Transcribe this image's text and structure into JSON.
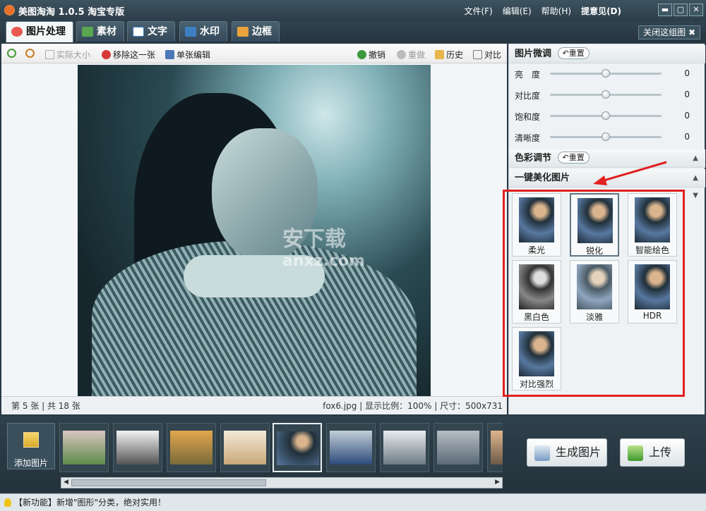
{
  "titlebar": {
    "title": "美图淘淘 1.0.5 淘宝专版"
  },
  "menu": [
    {
      "label": "文件(F)"
    },
    {
      "label": "编辑(E)"
    },
    {
      "label": "帮助(H)"
    },
    {
      "label": "提意见(D)"
    }
  ],
  "window_buttons": {
    "minimize": "▬",
    "maximize": "▢",
    "close": "✕"
  },
  "tabs": [
    {
      "label": "图片处理",
      "icon": "palette-icon",
      "color": "#e85a4f"
    },
    {
      "label": "素材",
      "icon": "material-icon",
      "color": "#5aa64f"
    },
    {
      "label": "文字",
      "icon": "text-icon",
      "color": "#3d7fc2"
    },
    {
      "label": "水印",
      "icon": "watermark-icon",
      "color": "#3d7fc2"
    },
    {
      "label": "边框",
      "icon": "frame-icon",
      "color": "#e8a33d"
    }
  ],
  "close_group": "关闭这组图 ✖",
  "toolbar": {
    "actual_size": "实际大小",
    "remove": "移除这一张",
    "single_edit": "单张编辑",
    "undo": "撤销",
    "redo": "重做",
    "history": "历史",
    "compare": "对比"
  },
  "watermark": {
    "main": "安下载",
    "sub": "anxz.com"
  },
  "status": {
    "index": "第 5 张",
    "total": "共 18 张",
    "file": "fox6.jpg",
    "zoom": "显示比例：100%",
    "size": "尺寸：500x731"
  },
  "panel": {
    "fine_tune": "图片微调",
    "reset": "重置",
    "sliders": [
      {
        "label": "亮　度",
        "value": 0,
        "fraction": 0.5
      },
      {
        "label": "对比度",
        "value": 0,
        "fraction": 0.5
      },
      {
        "label": "饱和度",
        "value": 0,
        "fraction": 0.5
      },
      {
        "label": "清晰度",
        "value": 0,
        "fraction": 0.5
      }
    ],
    "color_adjust": "色彩调节",
    "one_click": "一键美化图片",
    "effects": [
      {
        "label": "柔光"
      },
      {
        "label": "锐化"
      },
      {
        "label": "智能绘色"
      },
      {
        "label": "黑白色"
      },
      {
        "label": "淡雅"
      },
      {
        "label": "HDR"
      },
      {
        "label": "对比强烈"
      }
    ],
    "selected_effect": "锐化"
  },
  "filmstrip": {
    "add_label": "添加图片",
    "selected_index": 4
  },
  "actions": {
    "generate": "生成图片",
    "upload": "上传"
  },
  "footer": {
    "text": "【新功能】新增\"图形\"分类，绝对实用！"
  }
}
